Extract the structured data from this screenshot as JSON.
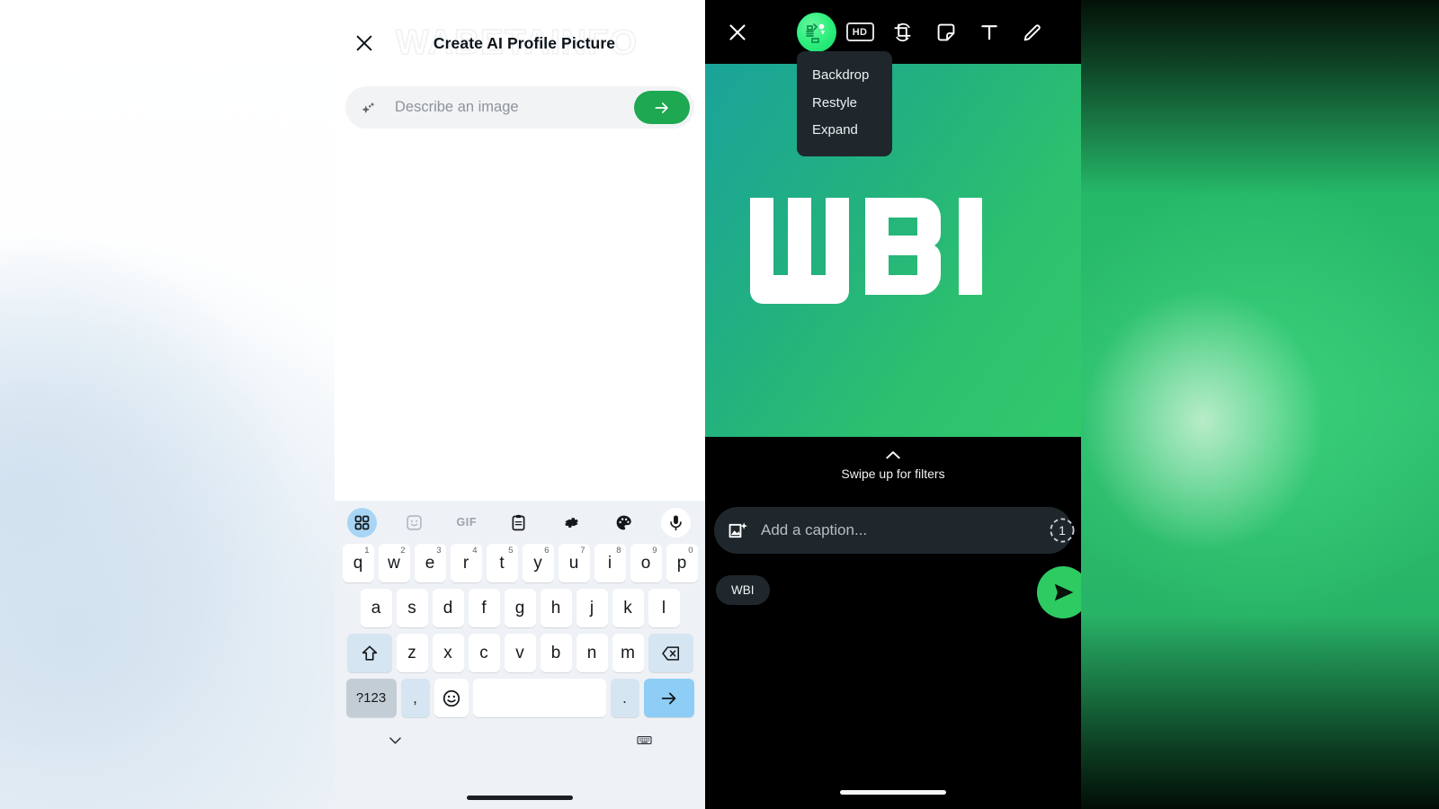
{
  "left_panel": {
    "watermark": "WABETAINFO",
    "close_icon": "close-icon",
    "title": "Create AI Profile Picture",
    "prompt": {
      "sparkle_icon": "sparkle-icon",
      "placeholder": "Describe an image",
      "value": "",
      "submit_icon": "arrow-right-icon",
      "submit_color": "#1da851"
    },
    "keyboard": {
      "toolbar": [
        {
          "name": "grid-icon",
          "label": "",
          "selected": true
        },
        {
          "name": "sticker-icon",
          "label": "",
          "selected": false
        },
        {
          "name": "gif-icon",
          "label": "GIF",
          "selected": false
        },
        {
          "name": "clipboard-icon",
          "label": "",
          "selected": false
        },
        {
          "name": "gear-icon",
          "label": "",
          "selected": false
        },
        {
          "name": "palette-icon",
          "label": "",
          "selected": false
        },
        {
          "name": "mic-icon",
          "label": "",
          "selected": false
        }
      ],
      "row1": [
        {
          "key": "q",
          "num": "1"
        },
        {
          "key": "w",
          "num": "2"
        },
        {
          "key": "e",
          "num": "3"
        },
        {
          "key": "r",
          "num": "4"
        },
        {
          "key": "t",
          "num": "5"
        },
        {
          "key": "y",
          "num": "6"
        },
        {
          "key": "u",
          "num": "7"
        },
        {
          "key": "i",
          "num": "8"
        },
        {
          "key": "o",
          "num": "9"
        },
        {
          "key": "p",
          "num": "0"
        }
      ],
      "row2": [
        "a",
        "s",
        "d",
        "f",
        "g",
        "h",
        "j",
        "k",
        "l"
      ],
      "row3": [
        "z",
        "x",
        "c",
        "v",
        "b",
        "n",
        "m"
      ],
      "shift_icon": "shift-icon",
      "backspace_icon": "backspace-icon",
      "symbols_key": "?123",
      "comma_key": ",",
      "emoji_icon": "emoji-icon",
      "space_key": "",
      "period_key": ".",
      "enter_icon": "arrow-right-icon",
      "nav_down_icon": "chevron-down-icon",
      "nav_keyboard_icon": "keyboard-icon"
    }
  },
  "right_panel": {
    "toolbar": [
      {
        "name": "close-icon",
        "label": ""
      },
      {
        "name": "ai-avatar-icon",
        "label": ""
      },
      {
        "name": "hd-icon",
        "label": "HD"
      },
      {
        "name": "crop-rotate-icon",
        "label": ""
      },
      {
        "name": "sticker-icon",
        "label": ""
      },
      {
        "name": "text-icon",
        "label": "T"
      },
      {
        "name": "draw-pencil-icon",
        "label": ""
      }
    ],
    "ai_menu": [
      "Backdrop",
      "Restyle",
      "Expand"
    ],
    "canvas": {
      "logo_text": "WBI",
      "gradient_from": "#1aa39a",
      "gradient_to": "#31c96c"
    },
    "filters_hint": {
      "chevron_icon": "chevron-up-icon",
      "label": "Swipe up for filters"
    },
    "caption": {
      "icon": "add-photo-icon",
      "placeholder": "Add a caption...",
      "value": "",
      "timer_badge": "1"
    },
    "recipient_chip": "WBI",
    "send": {
      "icon": "send-icon",
      "color": "#2ecb63"
    }
  }
}
